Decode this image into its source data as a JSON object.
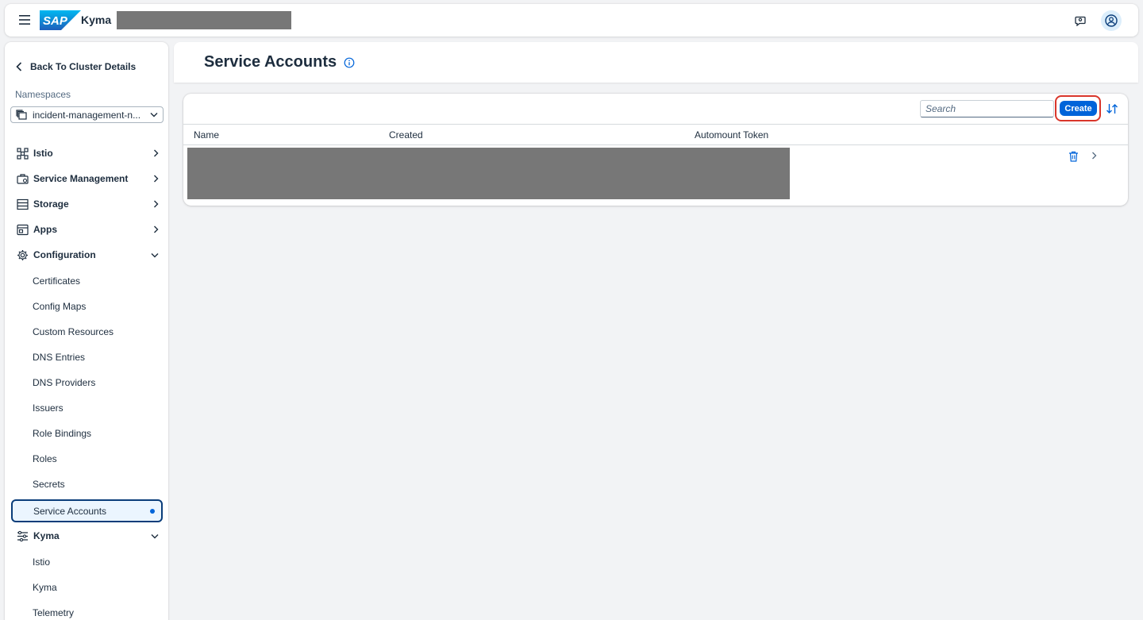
{
  "shellbar": {
    "logo_text": "SAP",
    "product_name": "Kyma",
    "colors": {
      "logo_blue": "#0a6ed1",
      "avatar_bg": "#dceefb"
    }
  },
  "sidebar": {
    "back_label": "Back To Cluster Details",
    "namespaces_label": "Namespaces",
    "namespace_value": "incident-management-n...",
    "groups": [
      {
        "label": "Istio",
        "icon": "network-icon",
        "expanded": false
      },
      {
        "label": "Service Management",
        "icon": "briefcase-icon",
        "expanded": false
      },
      {
        "label": "Storage",
        "icon": "storage-icon",
        "expanded": false
      },
      {
        "label": "Apps",
        "icon": "apps-icon",
        "expanded": false
      },
      {
        "label": "Configuration",
        "icon": "gear-icon",
        "expanded": true
      },
      {
        "label": "Kyma",
        "icon": "sliders-icon",
        "expanded": true
      }
    ],
    "configuration_items": [
      "Certificates",
      "Config Maps",
      "Custom Resources",
      "DNS Entries",
      "DNS Providers",
      "Issuers",
      "Role Bindings",
      "Roles",
      "Secrets",
      "Service Accounts"
    ],
    "selected_item": "Service Accounts",
    "kyma_items": [
      "Istio",
      "Kyma",
      "Telemetry"
    ]
  },
  "page": {
    "title": "Service Accounts"
  },
  "table": {
    "search_placeholder": "Search",
    "create_label": "Create",
    "columns": [
      "Name",
      "Created",
      "Automount Token"
    ],
    "accent_color": "#0064d9",
    "highlight_color": "#d9362b"
  }
}
